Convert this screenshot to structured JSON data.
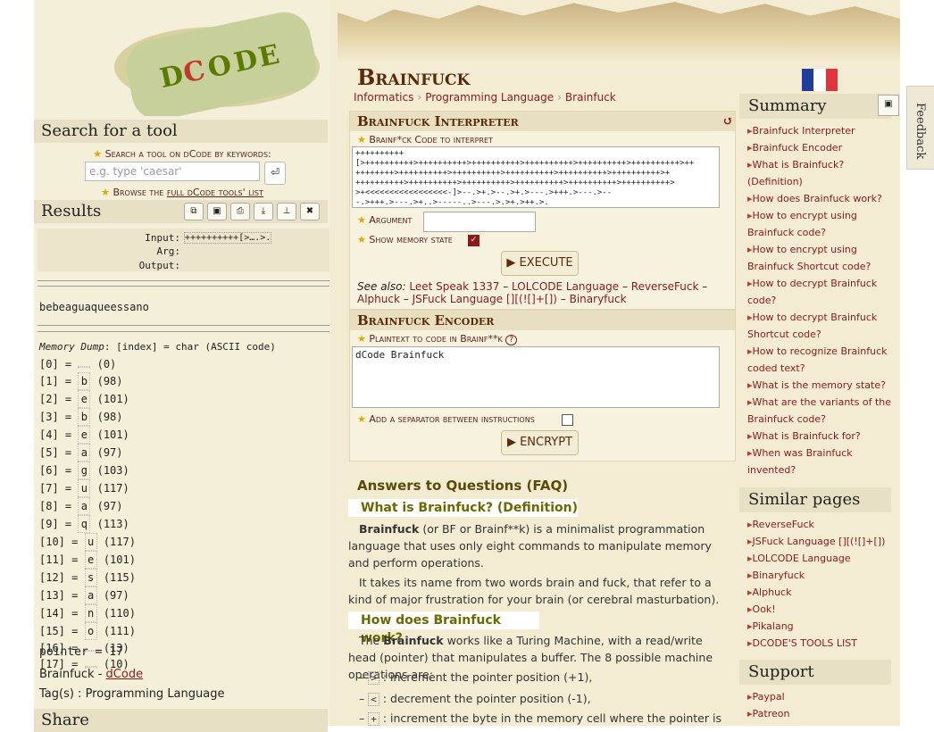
{
  "logo": {
    "text": "DCODE"
  },
  "search": {
    "header": "Search for a tool",
    "label": "Search a tool on dCode by keywords:",
    "placeholder": "e.g. type 'caesar'",
    "browse_prefix": "Browse the",
    "browse_link": "full dCode tools' list"
  },
  "results": {
    "header": "Results",
    "input_label": "Input:",
    "input_value": "++++++++++[>….>.",
    "arg_label": "Arg:",
    "output_label": "Output:",
    "decoded": "bebeaguaqueessano",
    "mem_title": "Memory Dump",
    "mem_header": ": [index] = char (ASCII code)",
    "memory": [
      {
        "idx": "[0] =",
        "ch": "",
        "code": "(0)"
      },
      {
        "idx": "[1] =",
        "ch": "b",
        "code": "(98)"
      },
      {
        "idx": "[2] =",
        "ch": "e",
        "code": "(101)"
      },
      {
        "idx": "[3] =",
        "ch": "b",
        "code": "(98)"
      },
      {
        "idx": "[4] =",
        "ch": "e",
        "code": "(101)"
      },
      {
        "idx": "[5] =",
        "ch": "a",
        "code": "(97)"
      },
      {
        "idx": "[6] =",
        "ch": "g",
        "code": "(103)"
      },
      {
        "idx": "[7] =",
        "ch": "u",
        "code": "(117)"
      },
      {
        "idx": "[8] =",
        "ch": "a",
        "code": "(97)"
      },
      {
        "idx": "[9] =",
        "ch": "q",
        "code": "(113)"
      },
      {
        "idx": "[10] =",
        "ch": "u",
        "code": "(117)"
      },
      {
        "idx": "[11] =",
        "ch": "e",
        "code": "(101)"
      },
      {
        "idx": "[12] =",
        "ch": "s",
        "code": "(115)"
      },
      {
        "idx": "[13] =",
        "ch": "a",
        "code": "(97)"
      },
      {
        "idx": "[14] =",
        "ch": "n",
        "code": "(110)"
      },
      {
        "idx": "[15] =",
        "ch": "o",
        "code": "(111)"
      },
      {
        "idx": "[16] =",
        "ch": "",
        "code": "(13)"
      },
      {
        "idx": "[17] =",
        "ch": "",
        "code": "(10)"
      }
    ],
    "pointer": "pointer = 17",
    "tag_line": "Brainfuck - ",
    "tag_link": "dCode",
    "tags": "Tag(s) : Programming Language"
  },
  "share": {
    "header": "Share"
  },
  "page": {
    "title": "Brainfuck",
    "breadcrumbs": [
      "Informatics",
      "Programming Language",
      "Brainfuck"
    ]
  },
  "interpreter": {
    "header": "Brainfuck Interpreter",
    "code_label": "Brainf*ck Code to interpret",
    "code": "++++++++++\n[>++++++++++>++++++++++>++++++++++>++++++++++>++++++++++>++++++++++>++\n++++++++>++++++++++>++++++++++>++++++++++>++++++++++>++++++++++>+\n++++++++++>++++++++++>++++++++++>++++++++++>++++++++++>++++++++++>\n>+<<<<<<<<<<<<<<<<<-]>--.>+.>--.>+.>---.>+++.>---.>--\n-.>+++.>---.>+..>-----..>---.>.>+.>++.>.",
    "argument_label": "Argument",
    "memory_label": "Show memory state",
    "execute": "EXECUTE",
    "see_also_label": "See also:",
    "see_also": [
      "Leet Speak 1337",
      "LOLCODE Language",
      "ReverseFuck",
      "Alphuck",
      "JSFuck Language [][(![]+[])",
      "Binaryfuck"
    ]
  },
  "encoder": {
    "header": "Brainfuck Encoder",
    "label": "Plaintext to code in Brainf**k",
    "value": "dCode Brainfuck",
    "separator_label": "Add a separator between instructions",
    "encrypt": "ENCRYPT"
  },
  "faq": {
    "header": "Answers to Questions (FAQ)",
    "q1": "What is Brainfuck? (Definition)",
    "p1a_bold": "Brainfuck",
    "p1a": " (or BF or Brainf**k) is a minimalist programmation language that uses only eight commands to manipulate memory and perform operations.",
    "p1b": "It takes its name from two words brain and fuck, that refer to a kind of major frustration for your brain (or cerebral masturbation).",
    "q2": "How does Brainfuck work?",
    "p2_pre": "The ",
    "p2_bold": "Brainfuck",
    "p2": " works like a Turing Machine, with a read/write head (pointer) that manipulates a buffer. The 8 possible machine operations are:",
    "ops": [
      {
        "key": ">",
        "text": ": increment the pointer position (+1),"
      },
      {
        "key": "<",
        "text": ": decrement the pointer position (-1),"
      },
      {
        "key": "+",
        "text": ": increment the byte in the memory cell where the pointer is"
      }
    ]
  },
  "summary": {
    "header": "Summary",
    "items": [
      "Brainfuck Interpreter",
      "Brainfuck Encoder",
      "What is Brainfuck? (Definition)",
      "How does Brainfuck work?",
      "How to encrypt using Brainfuck code?",
      "How to encrypt using Brainfuck Shortcut code?",
      "How to decrypt Brainfuck code?",
      "How to decrypt Brainfuck Shortcut code?",
      "How to recognize Brainfuck coded text?",
      "What is the memory state?",
      "What are the variants of the Brainfuck code?",
      "What is Brainfuck for?",
      "When was Brainfuck invented?"
    ]
  },
  "similar": {
    "header": "Similar pages",
    "items": [
      "ReverseFuck",
      "JSFuck Language [][(![]+[])",
      "LOLCODE Language",
      "Binaryfuck",
      "Alphuck",
      "Ook!",
      "Pikalang",
      "DCODE'S TOOLS LIST"
    ]
  },
  "support": {
    "header": "Support",
    "items": [
      "Paypal",
      "Patreon"
    ]
  },
  "feedback": "Feedback",
  "colors": {
    "accent": "#8b1a1a",
    "title": "#5a2a0a"
  }
}
